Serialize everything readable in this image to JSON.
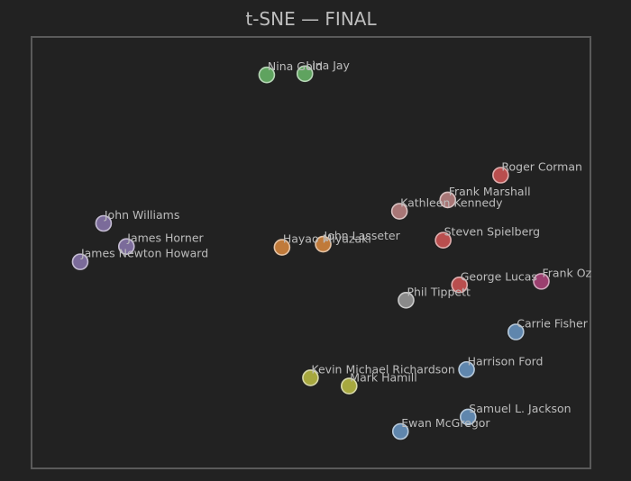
{
  "chart_data": {
    "type": "scatter",
    "title": "t-SNE — FINAL",
    "xlabel": "",
    "ylabel": "",
    "xlim": [
      0,
      100
    ],
    "ylim": [
      0,
      100
    ],
    "grid": false,
    "points": [
      {
        "label": "Nina Gold",
        "x": 41.3,
        "y": 95.6,
        "color": "#5fa35f"
      },
      {
        "label": "Lina Jay",
        "x": 48.8,
        "y": 95.9,
        "color": "#5fa35f"
      },
      {
        "label": "Roger Corman",
        "x": 87.3,
        "y": 70.0,
        "color": "#b94e4e"
      },
      {
        "label": "Frank Marshall",
        "x": 76.9,
        "y": 63.7,
        "color": "#a87676"
      },
      {
        "label": "Kathleen Kennedy",
        "x": 67.4,
        "y": 60.8,
        "color": "#a87676"
      },
      {
        "label": "Steven Spielberg",
        "x": 76.0,
        "y": 53.4,
        "color": "#b94e4e"
      },
      {
        "label": "John Williams",
        "x": 9.2,
        "y": 57.7,
        "color": "#7b6b9a"
      },
      {
        "label": "James Horner",
        "x": 13.7,
        "y": 51.8,
        "color": "#7b6b9a"
      },
      {
        "label": "James Newton Howard",
        "x": 4.6,
        "y": 47.9,
        "color": "#7b6b9a"
      },
      {
        "label": "Hayao Miyazaki",
        "x": 44.3,
        "y": 51.6,
        "color": "#c07a3a"
      },
      {
        "label": "John Lasseter",
        "x": 52.4,
        "y": 52.4,
        "color": "#c07a3a"
      },
      {
        "label": "George Lucas",
        "x": 79.2,
        "y": 42.0,
        "color": "#b94e4e"
      },
      {
        "label": "Frank Oz",
        "x": 95.3,
        "y": 42.9,
        "color": "#9b3f6f"
      },
      {
        "label": "Phil Tippett",
        "x": 68.7,
        "y": 38.1,
        "color": "#8a8a8a"
      },
      {
        "label": "Carrie Fisher",
        "x": 90.3,
        "y": 30.0,
        "color": "#5f86ad"
      },
      {
        "label": "Harrison Ford",
        "x": 80.6,
        "y": 20.4,
        "color": "#5f86ad"
      },
      {
        "label": "Kevin Michael Richardson",
        "x": 49.9,
        "y": 18.3,
        "color": "#a7a83f"
      },
      {
        "label": "Mark Hamill",
        "x": 57.5,
        "y": 16.2,
        "color": "#a7a83f"
      },
      {
        "label": "Samuel L. Jackson",
        "x": 80.9,
        "y": 8.3,
        "color": "#5f86ad"
      },
      {
        "label": "Ewan McGregor",
        "x": 67.6,
        "y": 4.6,
        "color": "#5f86ad"
      }
    ]
  }
}
